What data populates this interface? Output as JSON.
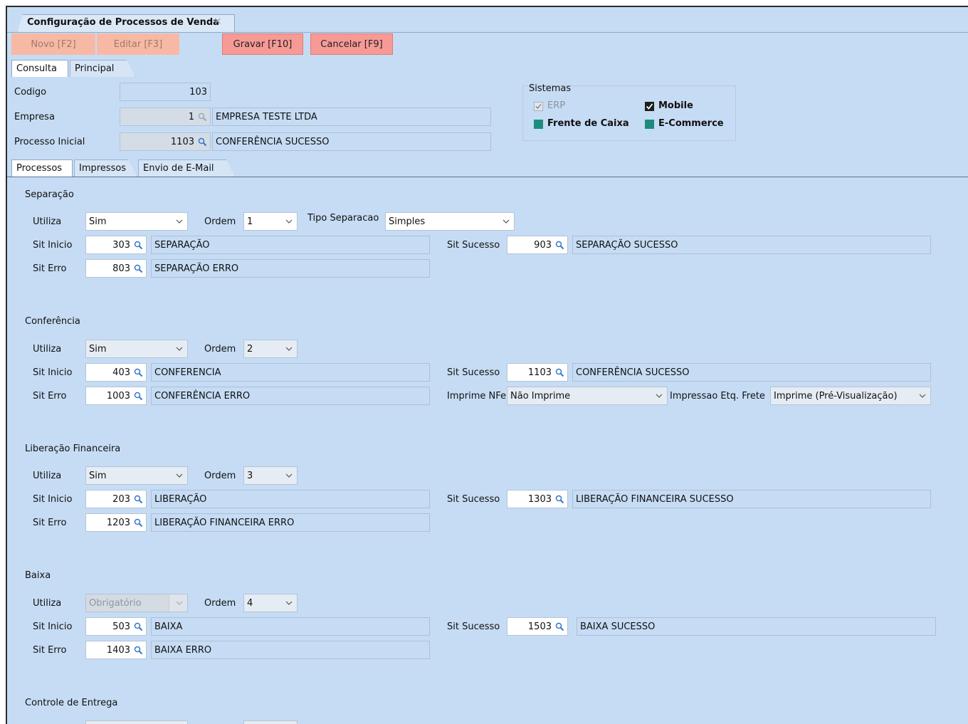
{
  "window": {
    "tab_title": "Configuração de Processos de Venda",
    "close_glyph": "×"
  },
  "toolbar": {
    "novo": "Novo [F2]",
    "editar": "Editar [F3]",
    "gravar": "Gravar [F10]",
    "cancelar": "Cancelar [F9]"
  },
  "top_tabs": [
    "Consulta",
    "Principal"
  ],
  "header": {
    "codigo_label": "Codigo",
    "codigo_value": "103",
    "empresa_label": "Empresa",
    "empresa_code": "1",
    "empresa_name": "EMPRESA TESTE LTDA",
    "processo_label": "Processo Inicial",
    "processo_code": "1103",
    "processo_name": "CONFERÊNCIA SUCESSO"
  },
  "sistemas": {
    "title": "Sistemas",
    "erp": "ERP",
    "mobile": "Mobile",
    "frente": "Frente de Caixa",
    "ecommerce": "E-Commerce"
  },
  "sub_tabs": [
    "Processos",
    "Impressos",
    "Envio de E-Mail"
  ],
  "labels": {
    "utiliza": "Utiliza",
    "ordem": "Ordem",
    "sit_inicio": "Sit Inicio",
    "sit_erro": "Sit Erro",
    "sit_sucesso": "Sit Sucesso",
    "tipo_separacao": "Tipo Separacao",
    "imprime_nfe": "Imprime NFe",
    "impressao_etq": "Impressao Etq. Frete"
  },
  "separacao": {
    "title": "Separação",
    "utiliza": "Sim",
    "ordem": "1",
    "tipo": "Simples",
    "inicio_code": "303",
    "inicio_name": "SEPARAÇÃO",
    "sucesso_code": "903",
    "sucesso_name": "SEPARAÇÃO SUCESSO",
    "erro_code": "803",
    "erro_name": "SEPARAÇÃO ERRO"
  },
  "conferencia": {
    "title": "Conferência",
    "utiliza": "Sim",
    "ordem": "2",
    "inicio_code": "403",
    "inicio_name": "CONFERENCIA",
    "sucesso_code": "1103",
    "sucesso_name": "CONFERÊNCIA SUCESSO",
    "erro_code": "1003",
    "erro_name": "CONFERÊNCIA ERRO",
    "imprime_nfe": "Não Imprime",
    "impressao_etq": "Imprime (Pré-Visualização)"
  },
  "liberacao": {
    "title": "Liberação Financeira",
    "utiliza": "Sim",
    "ordem": "3",
    "inicio_code": "203",
    "inicio_name": "LIBERAÇÃO",
    "sucesso_code": "1303",
    "sucesso_name": "LIBERAÇÃO FINANCEIRA SUCESSO",
    "erro_code": "1203",
    "erro_name": "LIBERAÇÃO FINANCEIRA ERRO"
  },
  "baixa": {
    "title": "Baixa",
    "utiliza": "Obrigatório",
    "ordem": "4",
    "inicio_code": "503",
    "inicio_name": "BAIXA",
    "sucesso_code": "1503",
    "sucesso_name": "BAIXA SUCESSO",
    "erro_code": "1403",
    "erro_name": "BAIXA ERRO"
  },
  "controle": {
    "title": "Controle de Entrega"
  }
}
